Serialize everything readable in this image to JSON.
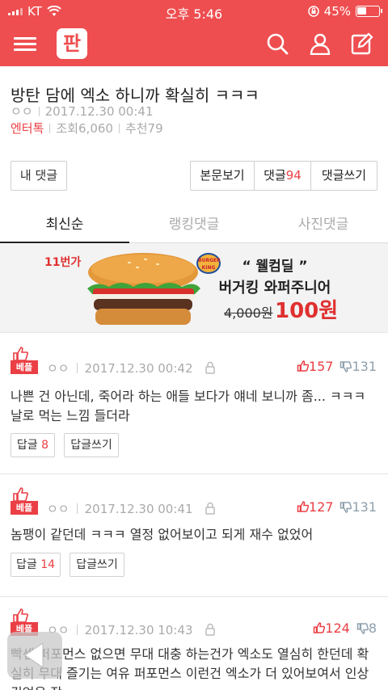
{
  "status": {
    "carrier": "KT",
    "time": "오후 5:46",
    "battery": "45%",
    "battery_level": 0.45
  },
  "article": {
    "title": "방탄 담에 엑소 하니까 확실히 ㅋㅋㅋ",
    "author": "ㅇㅇ",
    "date": "2017.12.30 00:41",
    "category": "엔터톡",
    "views": "조회6,060",
    "recommends": "추천79"
  },
  "buttons": {
    "my_comments": "내 댓글",
    "view_body": "본문보기",
    "comments_label": "댓글",
    "comments_count": "94",
    "write_comment": "댓글쓰기"
  },
  "tabs": [
    {
      "label": "최신순",
      "active": true
    },
    {
      "label": "랭킹댓글",
      "active": false
    },
    {
      "label": "사진댓글",
      "active": false
    }
  ],
  "ad": {
    "number": "11번가",
    "brand": "BURGER KING",
    "headline": "“ 웰컴딜 ”",
    "product": "버거킹 와퍼주니어",
    "old_price": "4,000원",
    "new_price": "100원"
  },
  "comments": [
    {
      "badge": "베플",
      "author": "ㅇㅇ",
      "date": "2017.12.30 00:42",
      "up": "157",
      "down": "131",
      "text": "나쁜 건 아닌데, 죽어라 하는 애들 보다가 얘네 보니까 좀... ㅋㅋㅋ 날로 먹는 느낌 들더라",
      "reply_label": "답글",
      "reply_count": "8",
      "write_reply": "답글쓰기"
    },
    {
      "badge": "베플",
      "author": "ㅇㅇ",
      "date": "2017.12.30 00:41",
      "up": "127",
      "down": "131",
      "text": "놈팽이 같던데 ㅋㅋㅋ 열정 없어보이고 되게 재수 없었어",
      "reply_label": "답글",
      "reply_count": "14",
      "write_reply": "답글쓰기"
    },
    {
      "badge": "베플",
      "author": "ㅇㅇ",
      "date": "2017.12.30 10:43",
      "up": "124",
      "down": "8",
      "text": "빡센 퍼포먼스 없으면 무대 대충 하는건가 엑소도 열심히 한던데 확실히 무대 즐기는 여유 퍼포먼스 이런건 엑소가 더 있어보여서 인상 깊었음 작"
    }
  ]
}
